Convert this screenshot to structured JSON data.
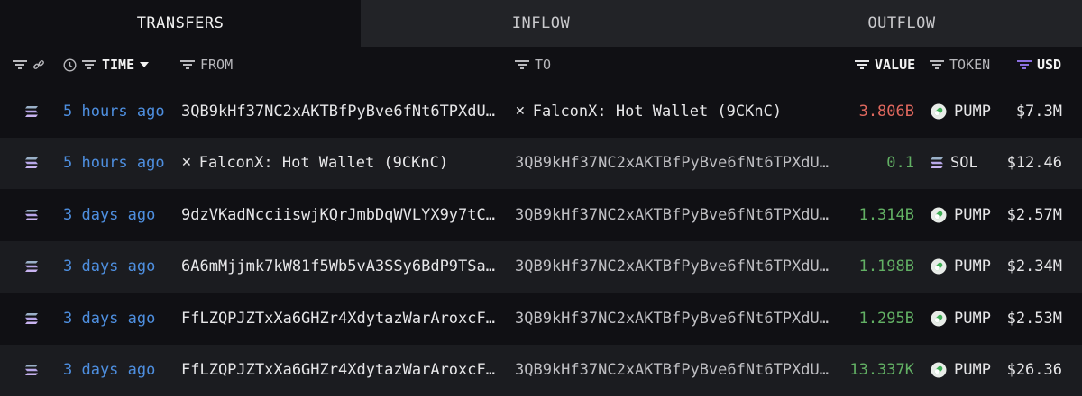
{
  "tabs": [
    {
      "label": "TRANSFERS"
    },
    {
      "label": "INFLOW"
    },
    {
      "label": "OUTFLOW"
    }
  ],
  "columns": {
    "time": "TIME",
    "from": "FROM",
    "to": "TO",
    "value": "VALUE",
    "token": "TOKEN",
    "usd": "USD"
  },
  "colors": {
    "accent": "#4e8fe0",
    "negative": "#e0685e",
    "positive": "#62b064",
    "usd_filter": "#8b6fe0"
  },
  "rows": [
    {
      "time": "5 hours ago",
      "from": "3QB9kHf37NC2xAKTBfPyBve6fNt6TPXdU…",
      "to": "FalconX: Hot Wallet (9CKnC)",
      "value": "3.806B",
      "token": "PUMP",
      "usd": "$7.3M"
    },
    {
      "time": "5 hours ago",
      "from": "FalconX: Hot Wallet (9CKnC)",
      "to": "3QB9kHf37NC2xAKTBfPyBve6fNt6TPXdU…",
      "value": "0.1",
      "token": "SOL",
      "usd": "$12.46"
    },
    {
      "time": "3 days ago",
      "from": "9dzVKadNcciiswjKQrJmbDqWVLYX9y7tC…",
      "to": "3QB9kHf37NC2xAKTBfPyBve6fNt6TPXdU…",
      "value": "1.314B",
      "token": "PUMP",
      "usd": "$2.57M"
    },
    {
      "time": "3 days ago",
      "from": "6A6mMjjmk7kW81f5Wb5vA3SSy6BdP9TSa…",
      "to": "3QB9kHf37NC2xAKTBfPyBve6fNt6TPXdU…",
      "value": "1.198B",
      "token": "PUMP",
      "usd": "$2.34M"
    },
    {
      "time": "3 days ago",
      "from": "FfLZQPJZTxXa6GHZr4XdytazWarAroxcF…",
      "to": "3QB9kHf37NC2xAKTBfPyBve6fNt6TPXdU…",
      "value": "1.295B",
      "token": "PUMP",
      "usd": "$2.53M"
    },
    {
      "time": "3 days ago",
      "from": "FfLZQPJZTxXa6GHZr4XdytazWarAroxcF…",
      "to": "3QB9kHf37NC2xAKTBfPyBve6fNt6TPXdU…",
      "value": "13.337K",
      "token": "PUMP",
      "usd": "$26.36"
    }
  ]
}
